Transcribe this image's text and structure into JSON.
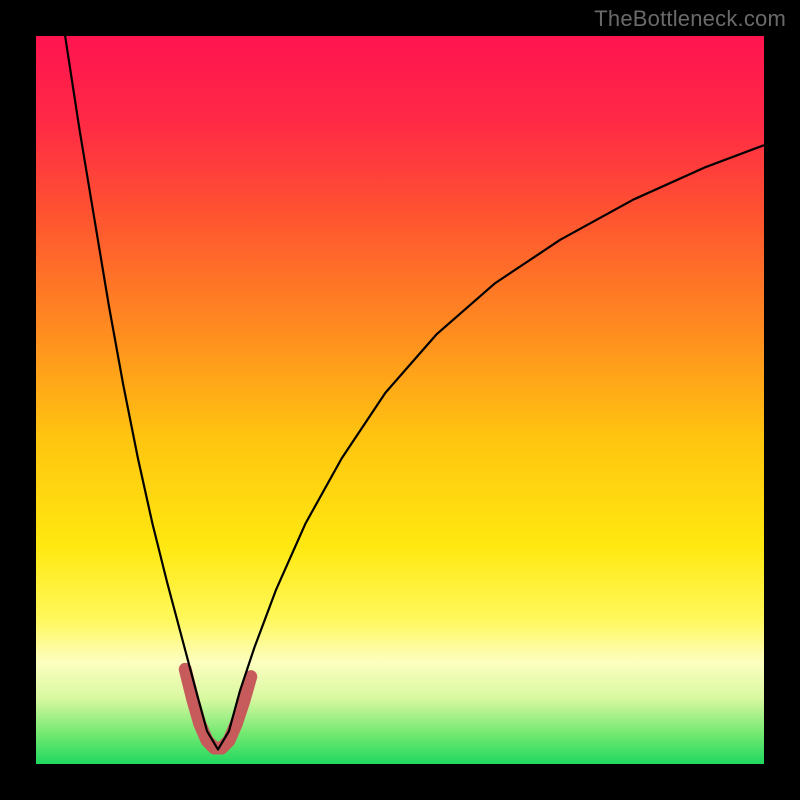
{
  "watermark": "TheBottleneck.com",
  "chart_data": {
    "type": "line",
    "title": "",
    "xlabel": "",
    "ylabel": "",
    "xlim": [
      0,
      100
    ],
    "ylim": [
      0,
      100
    ],
    "bottleneck_x": 25,
    "gradient_stops": [
      {
        "offset": 0.0,
        "color": "#ff1450"
      },
      {
        "offset": 0.12,
        "color": "#ff2a45"
      },
      {
        "offset": 0.25,
        "color": "#ff5530"
      },
      {
        "offset": 0.4,
        "color": "#ff8a20"
      },
      {
        "offset": 0.55,
        "color": "#ffc410"
      },
      {
        "offset": 0.7,
        "color": "#ffe810"
      },
      {
        "offset": 0.8,
        "color": "#fff85a"
      },
      {
        "offset": 0.86,
        "color": "#fdfec0"
      },
      {
        "offset": 0.91,
        "color": "#d8f8a0"
      },
      {
        "offset": 0.96,
        "color": "#70e870"
      },
      {
        "offset": 1.0,
        "color": "#20d860"
      }
    ],
    "main_curve": {
      "points": [
        {
          "x": 4.0,
          "y": 100.0
        },
        {
          "x": 6.0,
          "y": 87.0
        },
        {
          "x": 8.0,
          "y": 75.0
        },
        {
          "x": 10.0,
          "y": 63.0
        },
        {
          "x": 12.0,
          "y": 52.0
        },
        {
          "x": 14.0,
          "y": 42.0
        },
        {
          "x": 16.0,
          "y": 33.0
        },
        {
          "x": 18.0,
          "y": 25.0
        },
        {
          "x": 20.0,
          "y": 17.5
        },
        {
          "x": 22.0,
          "y": 10.0
        },
        {
          "x": 23.5,
          "y": 4.5
        },
        {
          "x": 25.0,
          "y": 2.0
        },
        {
          "x": 26.5,
          "y": 4.5
        },
        {
          "x": 28.0,
          "y": 10.0
        },
        {
          "x": 30.0,
          "y": 16.0
        },
        {
          "x": 33.0,
          "y": 24.0
        },
        {
          "x": 37.0,
          "y": 33.0
        },
        {
          "x": 42.0,
          "y": 42.0
        },
        {
          "x": 48.0,
          "y": 51.0
        },
        {
          "x": 55.0,
          "y": 59.0
        },
        {
          "x": 63.0,
          "y": 66.0
        },
        {
          "x": 72.0,
          "y": 72.0
        },
        {
          "x": 82.0,
          "y": 77.5
        },
        {
          "x": 92.0,
          "y": 82.0
        },
        {
          "x": 100.0,
          "y": 85.0
        }
      ],
      "stroke": "#000000",
      "width": 2.2
    },
    "highlight_curve": {
      "points": [
        {
          "x": 20.5,
          "y": 13.0
        },
        {
          "x": 21.5,
          "y": 9.0
        },
        {
          "x": 22.5,
          "y": 5.5
        },
        {
          "x": 23.5,
          "y": 3.2
        },
        {
          "x": 24.5,
          "y": 2.2
        },
        {
          "x": 25.5,
          "y": 2.2
        },
        {
          "x": 26.5,
          "y": 3.2
        },
        {
          "x": 27.5,
          "y": 5.5
        },
        {
          "x": 28.5,
          "y": 8.5
        },
        {
          "x": 29.5,
          "y": 12.0
        }
      ],
      "stroke": "#c75a5a",
      "width": 13,
      "linecap": "round"
    }
  }
}
